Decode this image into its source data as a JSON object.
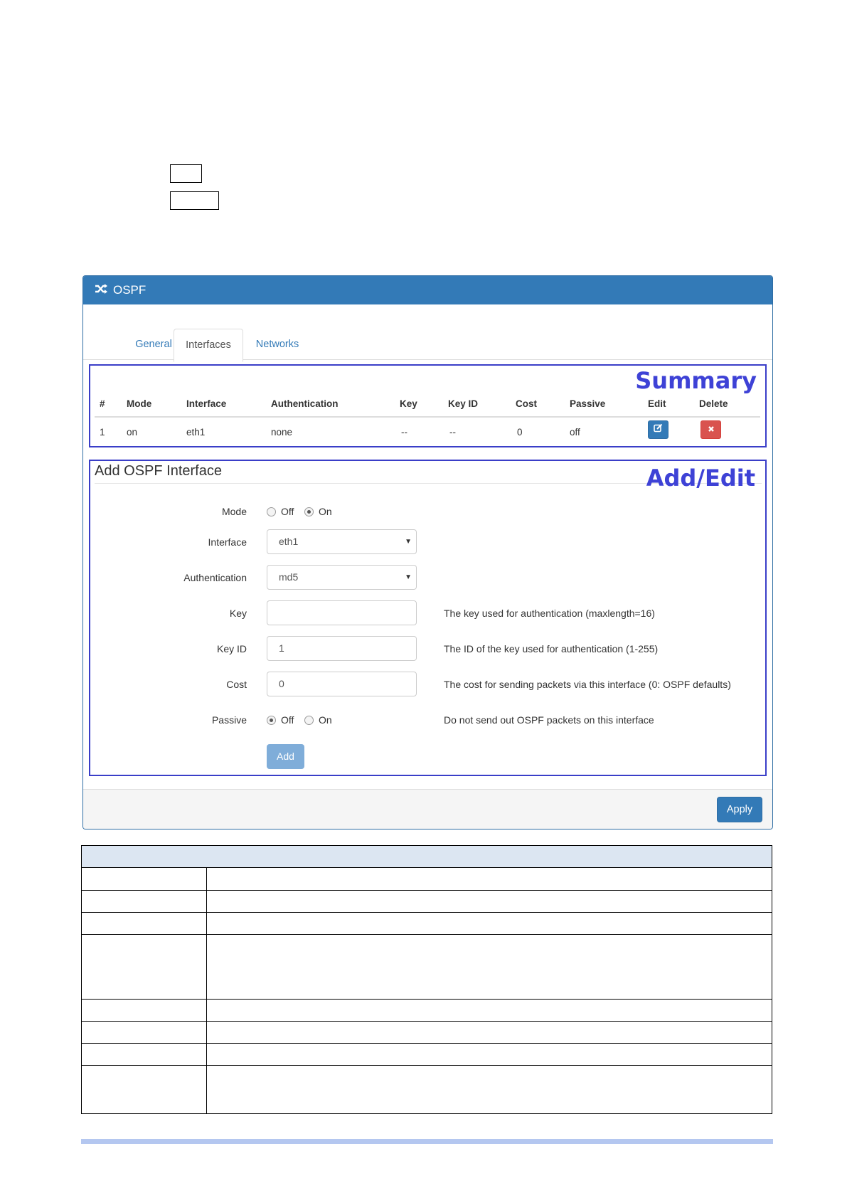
{
  "panel": {
    "title": "OSPF",
    "header_icon": "random-shuffle-icon",
    "header_color": "#337ab7"
  },
  "tabs": [
    {
      "label": "General",
      "active": false
    },
    {
      "label": "Interfaces",
      "active": true
    },
    {
      "label": "Networks",
      "active": false
    }
  ],
  "annotations": {
    "summary": "Summary",
    "add_edit": "Add/Edit",
    "color": "#3e42d6"
  },
  "summary_table": {
    "headers": [
      "#",
      "Mode",
      "Interface",
      "Authentication",
      "Key",
      "Key ID",
      "Cost",
      "Passive",
      "Edit",
      "Delete"
    ],
    "rows": [
      {
        "num": "1",
        "mode": "on",
        "interface": "eth1",
        "authentication": "none",
        "key": "--",
        "key_id": "--",
        "cost": "0",
        "passive": "off",
        "edit_icon": "edit-icon",
        "delete_icon": "delete-x-icon"
      }
    ]
  },
  "form": {
    "title": "Add OSPF Interface",
    "mode": {
      "label": "Mode",
      "options": [
        "Off",
        "On"
      ],
      "selected": "On"
    },
    "interface": {
      "label": "Interface",
      "value": "eth1"
    },
    "authentication": {
      "label": "Authentication",
      "value": "md5"
    },
    "key": {
      "label": "Key",
      "value": "",
      "help": "The key used for authentication (maxlength=16)"
    },
    "key_id": {
      "label": "Key ID",
      "value": "1",
      "help": "The ID of the key used for authentication (1-255)"
    },
    "cost": {
      "label": "Cost",
      "value": "0",
      "help": "The cost for sending packets via this interface (0: OSPF defaults)"
    },
    "passive": {
      "label": "Passive",
      "options": [
        "Off",
        "On"
      ],
      "selected": "Off",
      "help": "Do not send out OSPF packets on this interface"
    },
    "add_label": "Add"
  },
  "footer": {
    "apply_label": "Apply"
  }
}
